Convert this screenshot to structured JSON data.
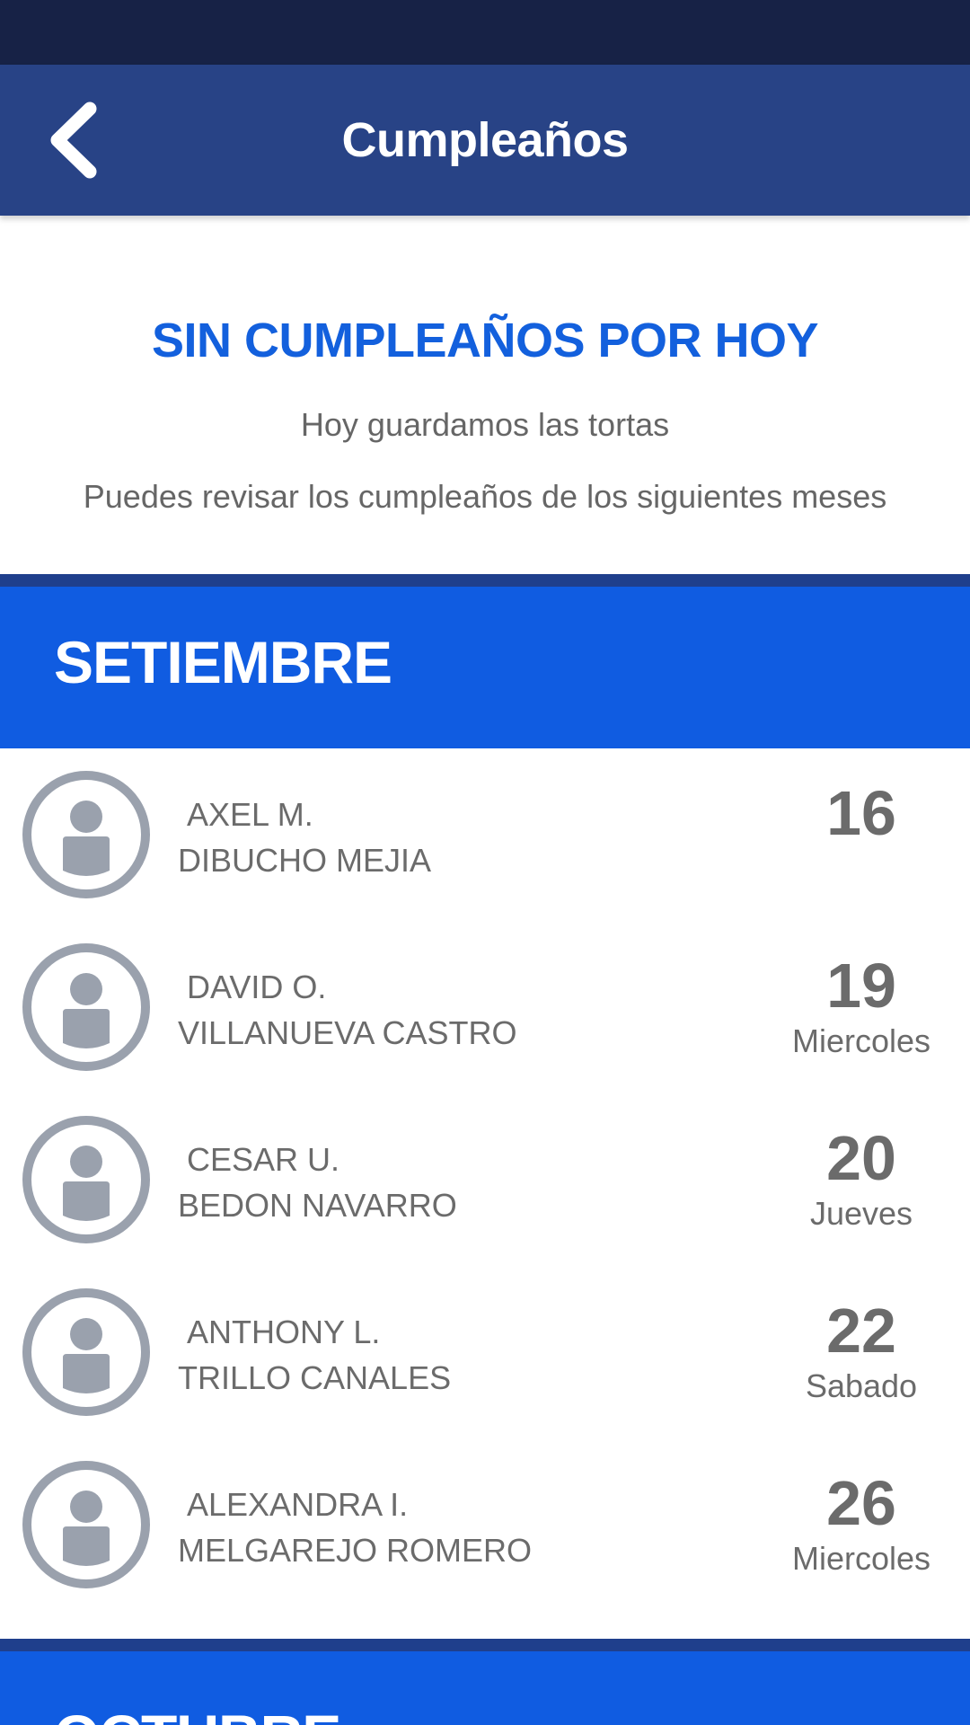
{
  "header": {
    "title": "Cumpleaños",
    "back_icon": "chevron-left-icon"
  },
  "empty_state": {
    "title": "SIN CUMPLEAÑOS POR HOY",
    "line1": "Hoy guardamos las tortas",
    "line2": "Puedes revisar los cumpleaños de los siguientes meses"
  },
  "months": [
    {
      "name": "SETIEMBRE",
      "birthdays": [
        {
          "first": "AXEL M.",
          "last": "DIBUCHO MEJIA",
          "day": "16",
          "weekday": ""
        },
        {
          "first": "DAVID O.",
          "last": "VILLANUEVA CASTRO",
          "day": "19",
          "weekday": "Miercoles"
        },
        {
          "first": "CESAR U.",
          "last": "BEDON NAVARRO",
          "day": "20",
          "weekday": "Jueves"
        },
        {
          "first": "ANTHONY L.",
          "last": "TRILLO CANALES",
          "day": "22",
          "weekday": "Sabado"
        },
        {
          "first": "ALEXANDRA I.",
          "last": "MELGAREJO ROMERO",
          "day": "26",
          "weekday": "Miercoles"
        }
      ]
    },
    {
      "name": "OCTUBRE"
    }
  ],
  "colors": {
    "status_bar": "#172246",
    "header": "#284386",
    "accent": "#1360dd",
    "month_band": "#105ce1",
    "text_gray": "#6b6b6b",
    "avatar_gray": "#9aa1ad"
  }
}
